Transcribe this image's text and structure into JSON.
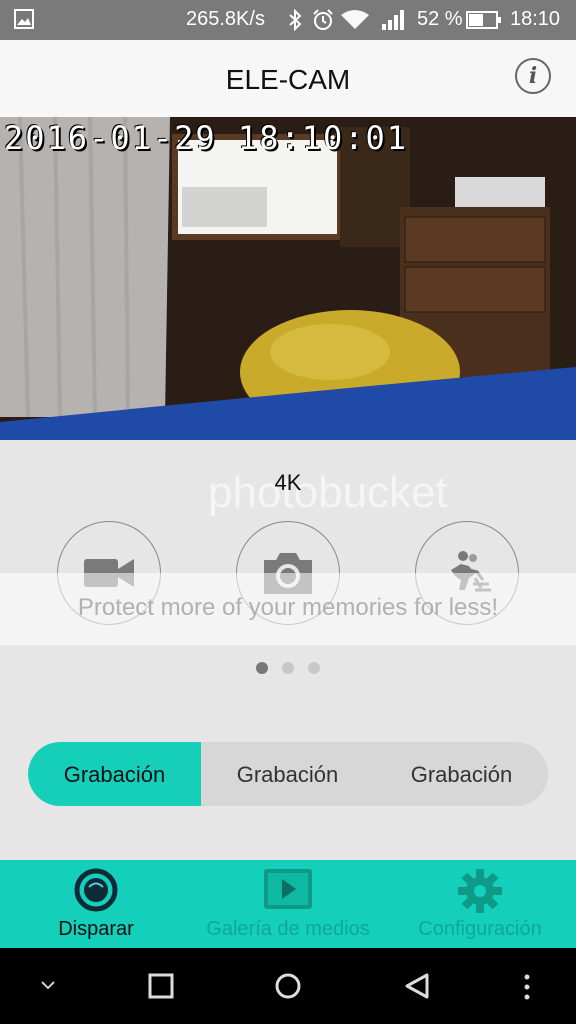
{
  "status_bar": {
    "network_speed": "265.8K/s",
    "battery_percent": "52 %",
    "time": "18:10",
    "icons": [
      "image-icon",
      "bluetooth-icon",
      "alarm-icon",
      "wifi-icon",
      "signal-icon",
      "battery-icon"
    ]
  },
  "app_bar": {
    "title": "ELE-CAM",
    "info_icon": "info-icon",
    "info_glyph": "i"
  },
  "video": {
    "timestamp": "2016-01-29 18:10:01"
  },
  "controls": {
    "resolution": "4K",
    "modes": [
      "video-camera-icon",
      "photo-camera-icon",
      "burst-motion-icon"
    ],
    "page_dots": {
      "count": 3,
      "active_index": 0
    }
  },
  "segments": [
    {
      "label": "Grabación",
      "active": true
    },
    {
      "label": "Grabación",
      "active": false
    },
    {
      "label": "Grabación",
      "active": false
    }
  ],
  "bottom_nav": [
    {
      "label": "Disparar",
      "icon": "shutter-icon",
      "active": true
    },
    {
      "label": "Galería de medios",
      "icon": "play-icon",
      "active": false
    },
    {
      "label": "Configuración",
      "icon": "gear-icon",
      "active": false
    }
  ],
  "watermark": {
    "logo": "photobucket",
    "text": "Protect more of your memories for less!"
  },
  "colors": {
    "accent": "#14cfb9",
    "active_nav_text": "#111111",
    "inactive_nav_text": "#0fa898"
  }
}
